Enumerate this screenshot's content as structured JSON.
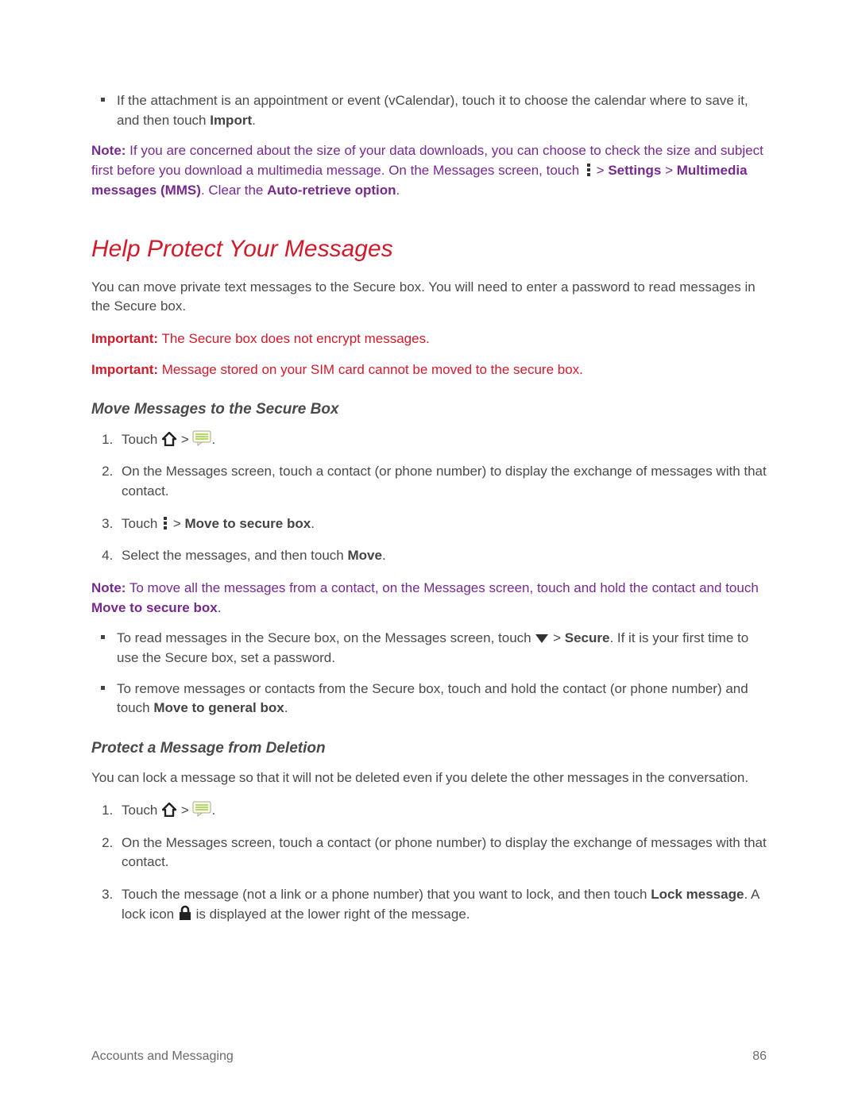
{
  "intro_bullet": {
    "pre": "If the attachment is an appointment or event (vCalendar), touch it to choose the calendar where to save it, and then touch ",
    "bold": "Import",
    "post": "."
  },
  "note1": {
    "label": "Note:",
    "pre": " If you are concerned about the size of your data downloads, you can choose to check the size and subject first before you download a multimedia message. On the Messages screen, touch ",
    "mid1": " > ",
    "b1": "Settings",
    "mid2": " > ",
    "b2": "Multimedia messages (MMS)",
    "mid3": ". Clear the ",
    "b3": "Auto-retrieve option",
    "post": "."
  },
  "h2": "Help Protect Your Messages",
  "p1": "You can move private text messages to the Secure box. You will need to enter a password to read messages in the Secure box.",
  "imp1": {
    "label": "Important:",
    "text": " The Secure box does not encrypt messages."
  },
  "imp2": {
    "label": "Important:",
    "text": " Message stored on your SIM card cannot be moved to the secure box."
  },
  "h3a": "Move Messages to the Secure Box",
  "stepsA": {
    "s1_pre": "Touch ",
    "s1_mid": " > ",
    "s1_post": ".",
    "s2": "On the Messages screen, touch a contact (or phone number) to display the exchange of messages with that contact.",
    "s3_pre": "Touch ",
    "s3_mid": " > ",
    "s3_bold": "Move to secure box",
    "s3_post": ".",
    "s4_pre": "Select the messages, and then touch ",
    "s4_bold": "Move",
    "s4_post": "."
  },
  "note2": {
    "label": "Note:",
    "pre": " To move all the messages from a contact, on the Messages screen, touch and hold the contact and touch ",
    "bold": "Move to secure box",
    "post": "."
  },
  "bulletsA": {
    "b1_pre": "To read messages in the Secure box, on the Messages screen, touch ",
    "b1_mid": " > ",
    "b1_bold": "Secure",
    "b1_post": ". If it is your first time to use the Secure box, set a password.",
    "b2_pre": "To remove messages or contacts from the Secure box, touch and hold the contact (or phone number) and touch ",
    "b2_bold": "Move to general box",
    "b2_post": "."
  },
  "h3b": "Protect a Message from Deletion",
  "p2": "You can lock a message so that it will not be deleted even if you delete the other messages in the conversation.",
  "stepsB": {
    "s1_pre": "Touch ",
    "s1_mid": " > ",
    "s1_post": ".",
    "s2": "On the Messages screen, touch a contact (or phone number) to display the exchange of messages with that contact.",
    "s3_pre": "Touch the message (not a link or a phone number) that you want to lock, and then touch ",
    "s3_bold": "Lock message",
    "s3_mid": ". A lock icon ",
    "s3_post": " is displayed at the lower right of the message."
  },
  "footer": {
    "section": "Accounts and Messaging",
    "page": "86"
  }
}
